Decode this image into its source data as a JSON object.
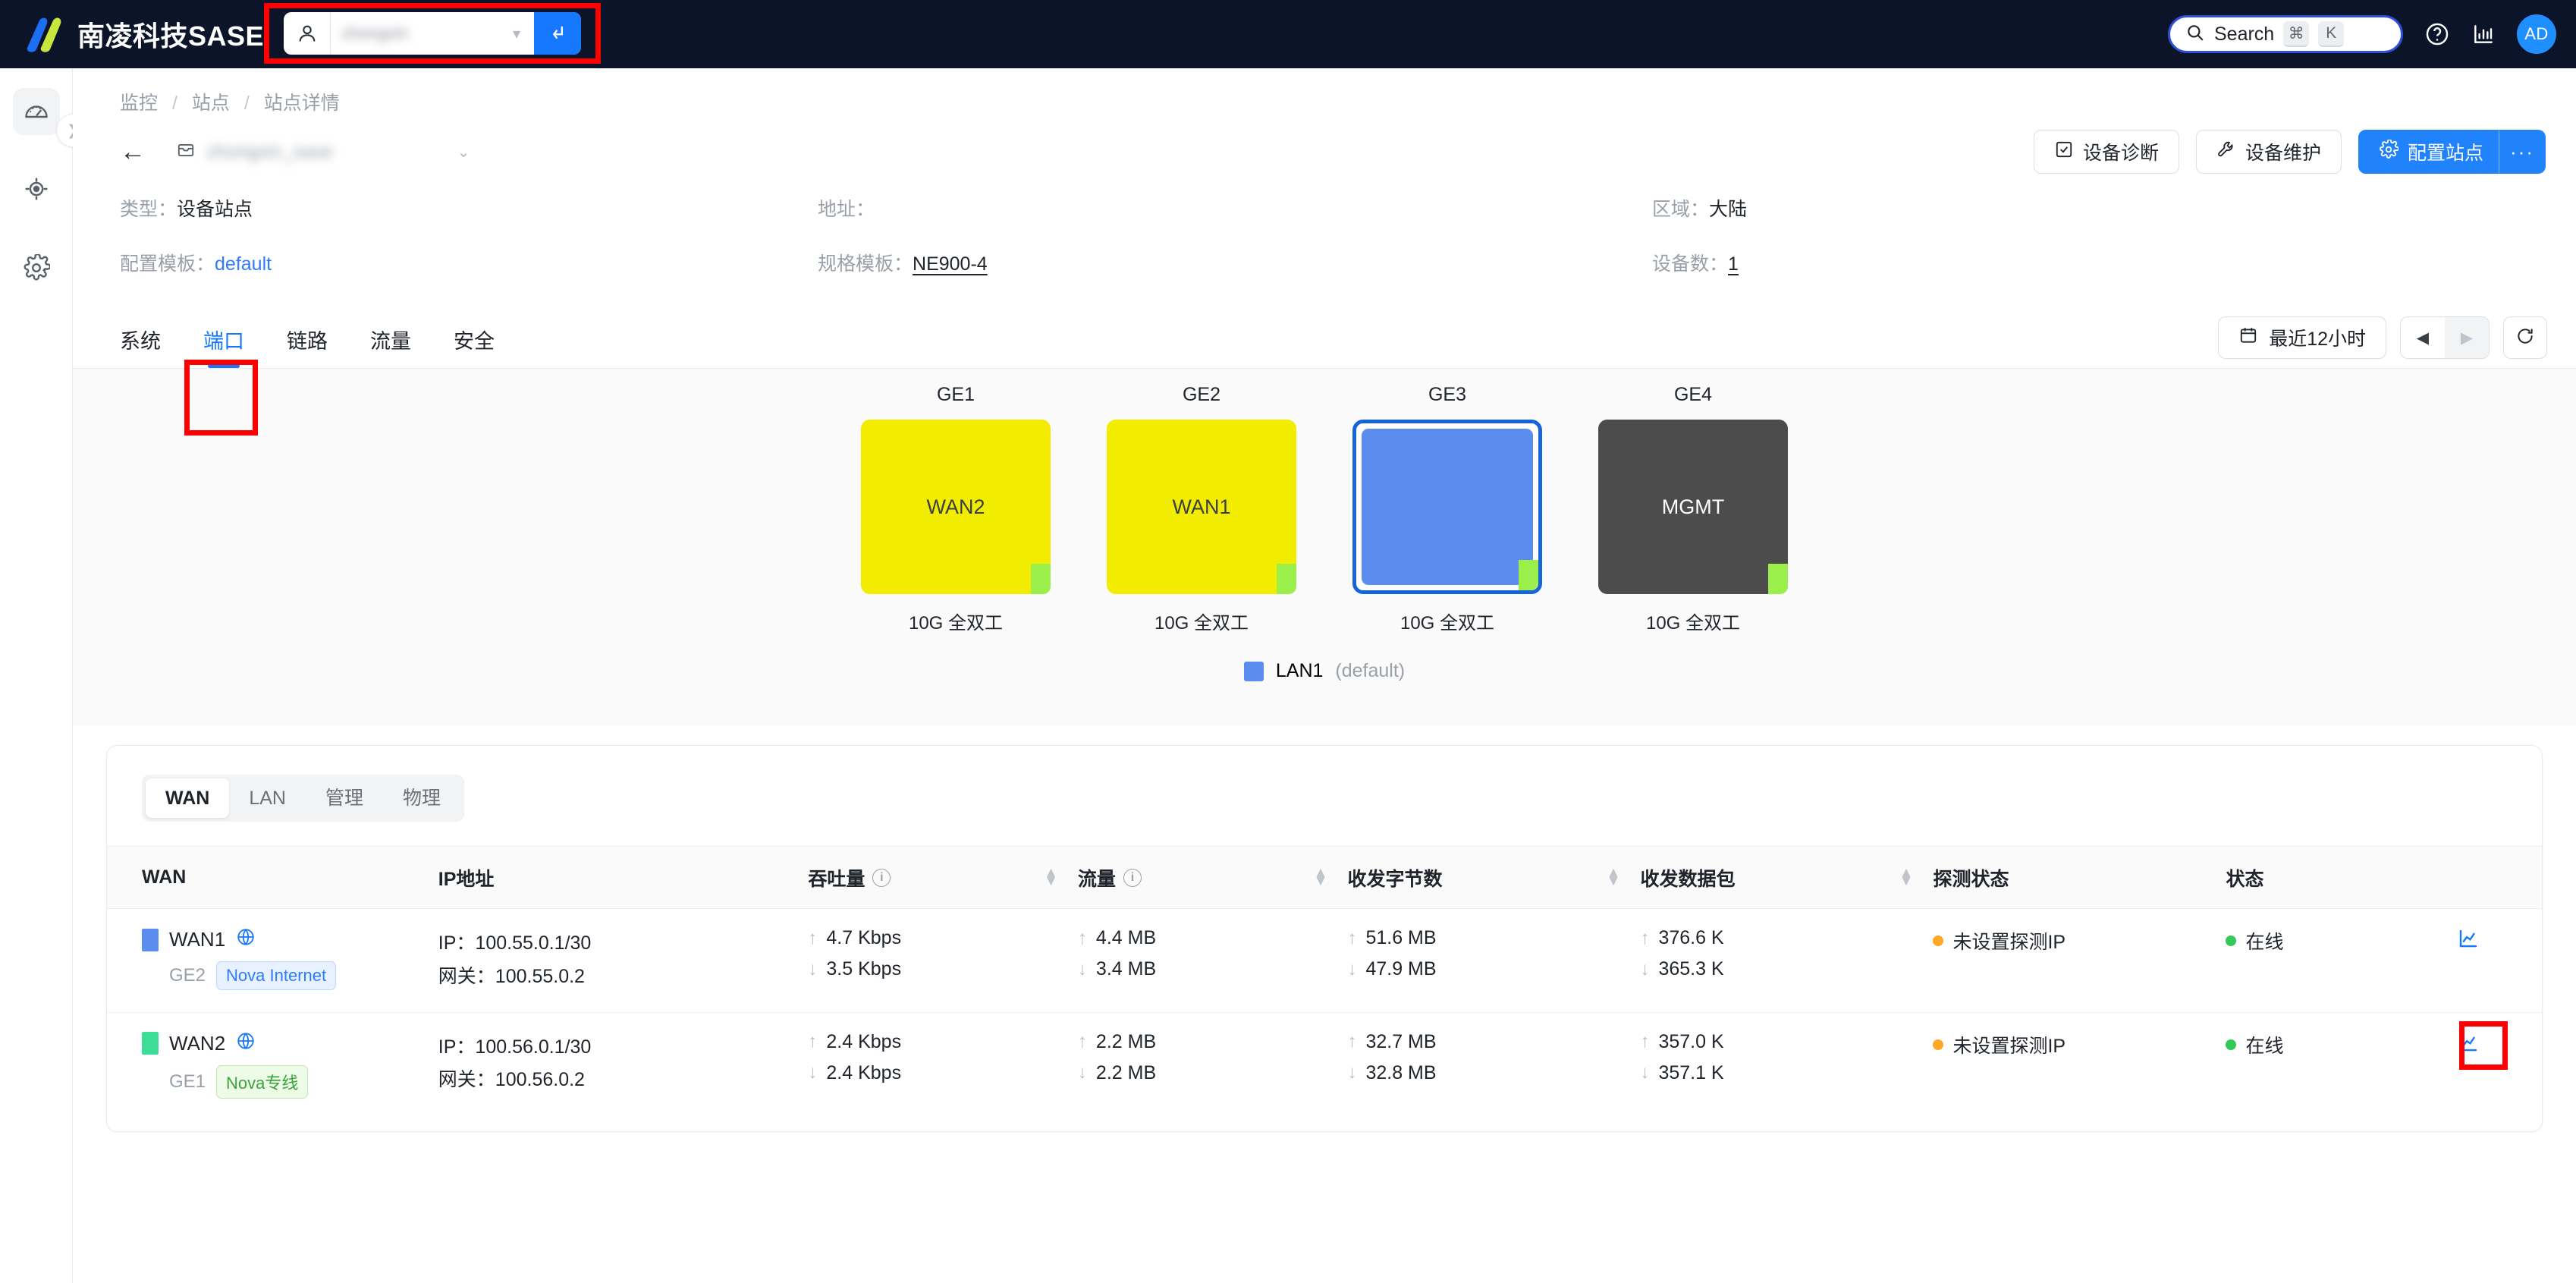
{
  "header": {
    "brand": "南凌科技SASE",
    "tenant_value_blurred": "zhongxin",
    "search": {
      "label": "Search",
      "keys": [
        "⌘",
        "K"
      ]
    },
    "avatar_initials": "AD"
  },
  "sidebar": {
    "items": [
      {
        "name": "dashboard",
        "icon": "gauge-icon",
        "active": true
      },
      {
        "name": "monitor",
        "icon": "target-icon",
        "active": false
      },
      {
        "name": "settings",
        "icon": "gear-icon",
        "active": false
      }
    ]
  },
  "breadcrumb": {
    "items": [
      "监控",
      "站点",
      "站点详情"
    ],
    "separator": "/"
  },
  "title_row": {
    "back": "←",
    "site_name_blurred": "zhongxin_sase",
    "caret": "⌄",
    "buttons": [
      {
        "label": "设备诊断",
        "icon": "check-square-icon"
      },
      {
        "label": "设备维护",
        "icon": "wrench-icon"
      },
      {
        "label": "配置站点",
        "icon": "gear-icon",
        "primary": true
      }
    ],
    "more_label": "···"
  },
  "meta": [
    {
      "label": "类型：",
      "value": "设备站点",
      "style": "plain"
    },
    {
      "label": "地址：",
      "value": "",
      "style": "plain"
    },
    {
      "label": "区域：",
      "value": "大陆",
      "style": "plain"
    },
    {
      "label": "配置模板：",
      "value": "default",
      "style": "link"
    },
    {
      "label": "规格模板：",
      "value": "NE900-4",
      "style": "underline"
    },
    {
      "label": "设备数：",
      "value": "1",
      "style": "underline"
    }
  ],
  "tabs": [
    {
      "label": "系统",
      "active": false
    },
    {
      "label": "端口",
      "active": true
    },
    {
      "label": "链路",
      "active": false
    },
    {
      "label": "流量",
      "active": false
    },
    {
      "label": "安全",
      "active": false
    }
  ],
  "time_controls": {
    "range_label": "最近12小时",
    "calendar_icon": "calendar-icon",
    "prev": "◀",
    "next": "▶",
    "refresh_icon": "refresh-icon"
  },
  "ports": [
    {
      "name": "GE1",
      "label": "WAN2",
      "speed": "10G 全双工",
      "color": "#f2ec00",
      "text_color": "#3a3f47",
      "selected": false
    },
    {
      "name": "GE2",
      "label": "WAN1",
      "speed": "10G 全双工",
      "color": "#f2ec00",
      "text_color": "#3a3f47",
      "selected": false
    },
    {
      "name": "GE3",
      "label": "",
      "speed": "10G 全双工",
      "color": "#5b8def",
      "text_color": "#ffffff",
      "selected": true
    },
    {
      "name": "GE4",
      "label": "MGMT",
      "speed": "10G 全双工",
      "color": "#4c4c4c",
      "text_color": "#ffffff",
      "selected": false
    }
  ],
  "legend": {
    "swatch_color": "#5b8def",
    "name": "LAN1",
    "suffix": "(default)"
  },
  "segmented": [
    {
      "label": "WAN",
      "active": true
    },
    {
      "label": "LAN",
      "active": false
    },
    {
      "label": "管理",
      "active": false
    },
    {
      "label": "物理",
      "active": false
    }
  ],
  "table": {
    "columns": [
      {
        "label": "WAN",
        "info": false,
        "sortable": false
      },
      {
        "label": "IP地址",
        "info": false,
        "sortable": false
      },
      {
        "label": "吞吐量",
        "info": true,
        "sortable": true
      },
      {
        "label": "流量",
        "info": true,
        "sortable": true
      },
      {
        "label": "收发字节数",
        "info": false,
        "sortable": true
      },
      {
        "label": "收发数据包",
        "info": false,
        "sortable": true
      },
      {
        "label": "探测状态",
        "info": false,
        "sortable": false
      },
      {
        "label": "状态",
        "info": false,
        "sortable": false
      },
      {
        "label": "",
        "info": false,
        "sortable": false
      }
    ],
    "rows": [
      {
        "swatch_color": "#5b8def",
        "wan": "WAN1",
        "globe_icon": "globe-icon",
        "port": "GE2",
        "badge": {
          "text": "Nova Internet",
          "tone": "blue"
        },
        "ip": "IP：100.55.0.1/30",
        "gateway": "网关：100.55.0.2",
        "throughput_up": "4.7 Kbps",
        "throughput_down": "3.5 Kbps",
        "traffic_up": "4.4 MB",
        "traffic_down": "3.4 MB",
        "bytes_up": "51.6 MB",
        "bytes_down": "47.9 MB",
        "packets_up": "376.6 K",
        "packets_down": "365.3 K",
        "probe_status": "未设置探测IP",
        "probe_tone": "orange",
        "status": "在线",
        "status_tone": "green",
        "action_icon": "line-chart-icon"
      },
      {
        "swatch_color": "#3ddc97",
        "wan": "WAN2",
        "globe_icon": "globe-icon",
        "port": "GE1",
        "badge": {
          "text": "Nova专线",
          "tone": "green"
        },
        "ip": "IP：100.56.0.1/30",
        "gateway": "网关：100.56.0.2",
        "throughput_up": "2.4 Kbps",
        "throughput_down": "2.4 Kbps",
        "traffic_up": "2.2 MB",
        "traffic_down": "2.2 MB",
        "bytes_up": "32.7 MB",
        "bytes_down": "32.8 MB",
        "packets_up": "357.0 K",
        "packets_down": "357.1 K",
        "probe_status": "未设置探测IP",
        "probe_tone": "orange",
        "status": "在线",
        "status_tone": "green",
        "action_icon": "line-chart-icon"
      }
    ]
  },
  "annotations": [
    {
      "name": "tenant-picker-highlight",
      "color": "#ff0000"
    },
    {
      "name": "port-tab-highlight",
      "color": "#ff0000"
    },
    {
      "name": "chart-action-highlight",
      "color": "#ff0000"
    }
  ],
  "arrows": {
    "up": "↑",
    "down": "↓"
  }
}
